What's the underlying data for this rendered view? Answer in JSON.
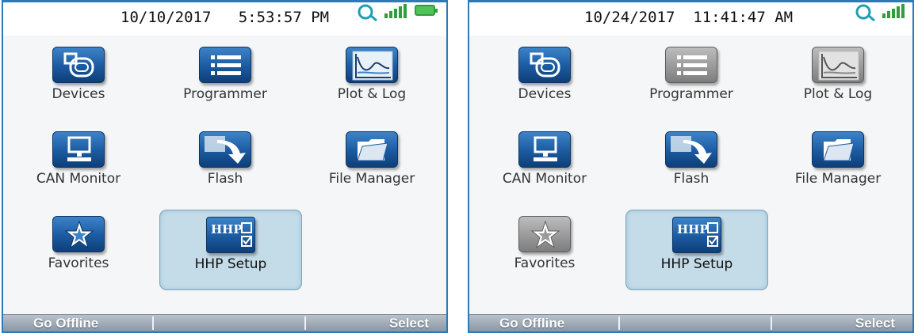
{
  "screens": [
    {
      "datetime": "10/10/2017   5:53:57 PM",
      "apps": [
        {
          "label": "Devices",
          "icon": "devices-icon",
          "enabled": true
        },
        {
          "label": "Programmer",
          "icon": "programmer-list-icon",
          "enabled": true
        },
        {
          "label": "Plot & Log",
          "icon": "plot-log-chart-icon",
          "enabled": true
        },
        {
          "label": "CAN Monitor",
          "icon": "can-monitor-computer-icon",
          "enabled": true
        },
        {
          "label": "Flash",
          "icon": "flash-arrow-icon",
          "enabled": true
        },
        {
          "label": "File Manager",
          "icon": "folder-icon",
          "enabled": true
        },
        {
          "label": "Favorites",
          "icon": "favorites-star-icon",
          "enabled": true
        },
        {
          "label": "HHP Setup",
          "icon": "hhp-setup-icon",
          "icon_text": "HHP",
          "enabled": true,
          "selected": true
        }
      ],
      "status_icons": [
        "connection-icon",
        "signal-strength-icon",
        "battery-icon"
      ],
      "softkeys": {
        "left": "Go Offline",
        "center": "",
        "right": "Select"
      }
    },
    {
      "datetime": "10/24/2017  11:41:47 AM",
      "apps": [
        {
          "label": "Devices",
          "icon": "devices-icon",
          "enabled": true
        },
        {
          "label": "Programmer",
          "icon": "programmer-list-icon",
          "enabled": false
        },
        {
          "label": "Plot & Log",
          "icon": "plot-log-chart-icon",
          "enabled": false
        },
        {
          "label": "CAN Monitor",
          "icon": "can-monitor-computer-icon",
          "enabled": true
        },
        {
          "label": "Flash",
          "icon": "flash-arrow-icon",
          "enabled": true
        },
        {
          "label": "File Manager",
          "icon": "folder-icon",
          "enabled": true
        },
        {
          "label": "Favorites",
          "icon": "favorites-star-icon",
          "enabled": false
        },
        {
          "label": "HHP Setup",
          "icon": "hhp-setup-icon",
          "icon_text": "HHP",
          "enabled": true,
          "selected": true
        }
      ],
      "status_icons": [
        "connection-icon",
        "signal-strength-icon"
      ],
      "softkeys": {
        "left": "Go Offline",
        "center": "",
        "right": "Select"
      }
    }
  ],
  "colors": {
    "icon_blue": "#1b5aa0",
    "icon_disabled": "#9a9a9a",
    "selection_bg": "#c4dbe8",
    "softkey_bar": "#8b97a3",
    "screen_border": "#2c7bb8"
  }
}
